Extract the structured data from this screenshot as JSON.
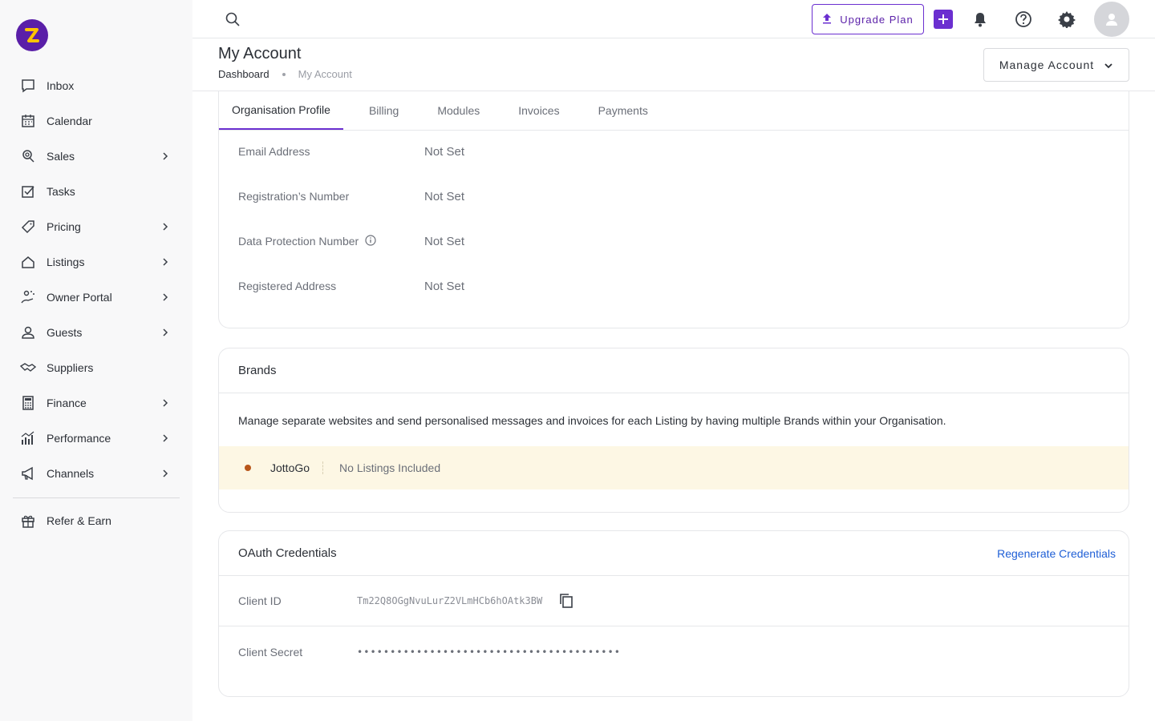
{
  "sidebar": {
    "items": [
      {
        "label": "Inbox",
        "icon": "inbox-icon",
        "has_submenu": false
      },
      {
        "label": "Calendar",
        "icon": "calendar-icon",
        "has_submenu": false
      },
      {
        "label": "Sales",
        "icon": "sales-icon",
        "has_submenu": true
      },
      {
        "label": "Tasks",
        "icon": "tasks-icon",
        "has_submenu": false
      },
      {
        "label": "Pricing",
        "icon": "tag-icon",
        "has_submenu": true
      },
      {
        "label": "Listings",
        "icon": "home-icon",
        "has_submenu": true
      },
      {
        "label": "Owner Portal",
        "icon": "owner-icon",
        "has_submenu": true
      },
      {
        "label": "Guests",
        "icon": "user-icon",
        "has_submenu": true
      },
      {
        "label": "Suppliers",
        "icon": "handshake-icon",
        "has_submenu": false
      },
      {
        "label": "Finance",
        "icon": "calculator-icon",
        "has_submenu": true
      },
      {
        "label": "Performance",
        "icon": "bar-chart-icon",
        "has_submenu": true
      },
      {
        "label": "Channels",
        "icon": "megaphone-icon",
        "has_submenu": true
      }
    ],
    "footer_item": {
      "label": "Refer & Earn",
      "icon": "gift-icon"
    }
  },
  "topbar": {
    "upgrade_label": "Upgrade Plan"
  },
  "header": {
    "title": "My Account",
    "breadcrumb": {
      "home": "Dashboard",
      "current": "My Account"
    },
    "manage_label": "Manage Account"
  },
  "tabs": [
    "Organisation Profile",
    "Billing",
    "Modules",
    "Invoices",
    "Payments"
  ],
  "profile": {
    "fields": [
      {
        "label": "Email Address",
        "value": "Not Set"
      },
      {
        "label": "Registration’s Number",
        "value": "Not Set"
      },
      {
        "label": "Data Protection Number",
        "value": "Not Set"
      },
      {
        "label": "Registered Address",
        "value": "Not Set"
      }
    ]
  },
  "brands": {
    "title": "Brands",
    "description": "Manage separate websites and send personalised messages and invoices for each Listing by having multiple Brands within your Organisation.",
    "items": [
      {
        "name": "JottoGo",
        "listings": "No Listings Included"
      }
    ]
  },
  "oauth": {
    "title": "OAuth Credentials",
    "regenerate_label": "Regenerate Credentials",
    "client_id_label": "Client ID",
    "client_id": "Tm22Q8OGgNvuLurZ2VLmHCb6hOAtk3BW",
    "client_secret_label": "Client Secret",
    "client_secret": "••••••••••••••••••••••••••••••••••••••••"
  },
  "colors": {
    "brand_purple": "#6b2fd0",
    "link_blue": "#1f5fd6",
    "brand_row_bg": "#fdf7e4",
    "brand_dot": "#b8561a"
  }
}
